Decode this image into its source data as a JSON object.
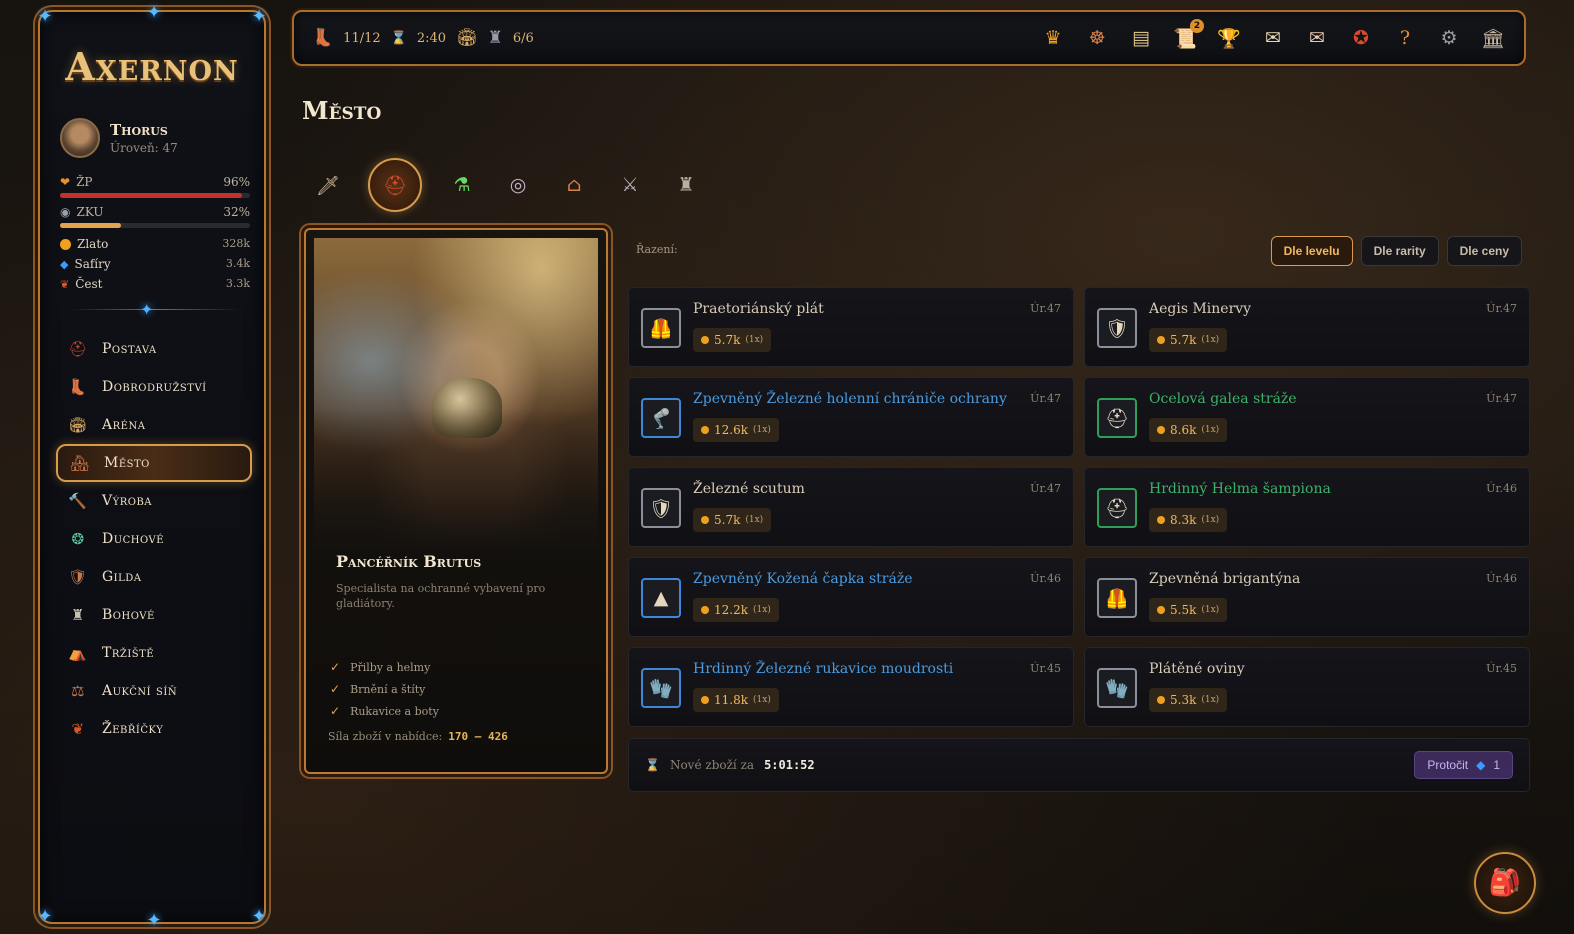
{
  "brand": {
    "logo": "Axernon"
  },
  "player": {
    "name": "Thorus",
    "level_label": "Úroveň: 47"
  },
  "stats": {
    "hp": {
      "label": "ŽP",
      "value": "96%",
      "fraction": 0.96,
      "color": "#c4302a"
    },
    "xp": {
      "label": "ZKU",
      "value": "32%",
      "fraction": 0.32,
      "color": "#e2a450"
    }
  },
  "resources": [
    {
      "label": "Zlato",
      "value": "328k",
      "color": "#f0a020"
    },
    {
      "label": "Safíry",
      "value": "3.4k",
      "color": "#3a9cff"
    },
    {
      "label": "Čest",
      "value": "3.3k",
      "color": "#d8582a"
    }
  ],
  "nav": [
    {
      "label": "Postava",
      "icon": "helmet-icon"
    },
    {
      "label": "Dobrodružství",
      "icon": "boot-icon"
    },
    {
      "label": "Aréna",
      "icon": "colosseum-icon"
    },
    {
      "label": "Město",
      "icon": "town-icon",
      "active": true
    },
    {
      "label": "Výroba",
      "icon": "hammer-icon"
    },
    {
      "label": "Duchové",
      "icon": "spirit-icon"
    },
    {
      "label": "Gilda",
      "icon": "shield-icon"
    },
    {
      "label": "Bohové",
      "icon": "statue-icon"
    },
    {
      "label": "Tržiště",
      "icon": "market-icon"
    },
    {
      "label": "Aukční síň",
      "icon": "auction-icon"
    },
    {
      "label": "Žebříčky",
      "icon": "laurel-icon"
    }
  ],
  "topbar": {
    "expeditions": "11/12",
    "timer": "2:40",
    "dungeon": "6/6",
    "quest_badge": "2"
  },
  "page": {
    "title": "Město"
  },
  "merchant": {
    "name": "Pancéřník Brutus",
    "description": "Specialista na ochranné vybavení pro gladiátory.",
    "specialties": [
      "Přilby a helmy",
      "Brnění a štíty",
      "Rukavice a boty"
    ],
    "power_label": "Síla zboží v nabídce:",
    "power_range": "170 – 426"
  },
  "sort": {
    "label": "Řazení:",
    "options": [
      "Dle levelu",
      "Dle rarity",
      "Dle ceny"
    ],
    "active": "Dle levelu"
  },
  "items": [
    {
      "name": "Praetoriánský plát",
      "level": "Úr.47",
      "price": "5.7k",
      "qty": "(1x)",
      "rarity_color": "#d8ccb6",
      "border": "#8a8f99",
      "icon": "breastplate-icon",
      "glyph": "🦺"
    },
    {
      "name": "Aegis Minervy",
      "level": "Úr.47",
      "price": "5.7k",
      "qty": "(1x)",
      "rarity_color": "#d8ccb6",
      "border": "#8a8f99",
      "icon": "shield-icon",
      "glyph": "🛡"
    },
    {
      "name": "Zpevněný Železné holenní chrániče ochrany",
      "level": "Úr.47",
      "price": "12.6k",
      "qty": "(1x)",
      "rarity_color": "#4a9be0",
      "border": "#3d87d6",
      "icon": "greaves-icon",
      "glyph": "🦿"
    },
    {
      "name": "Ocelová galea stráže",
      "level": "Úr.47",
      "price": "8.6k",
      "qty": "(1x)",
      "rarity_color": "#3cb26a",
      "border": "#2e9e58",
      "icon": "helmet-icon",
      "glyph": "⛑"
    },
    {
      "name": "Železné scutum",
      "level": "Úr.47",
      "price": "5.7k",
      "qty": "(1x)",
      "rarity_color": "#d8ccb6",
      "border": "#8a8f99",
      "icon": "shield-icon",
      "glyph": "🛡"
    },
    {
      "name": "Hrdinný Helma šampiona",
      "level": "Úr.46",
      "price": "8.3k",
      "qty": "(1x)",
      "rarity_color": "#3cb26a",
      "border": "#2e9e58",
      "icon": "helmet-icon",
      "glyph": "⛑"
    },
    {
      "name": "Zpevněný Kožená čapka stráže",
      "level": "Úr.46",
      "price": "12.2k",
      "qty": "(1x)",
      "rarity_color": "#4a9be0",
      "border": "#3d87d6",
      "icon": "cap-icon",
      "glyph": "▲"
    },
    {
      "name": "Zpevněná brigantýna",
      "level": "Úr.46",
      "price": "5.5k",
      "qty": "(1x)",
      "rarity_color": "#d8ccb6",
      "border": "#8a8f99",
      "icon": "brigandine-icon",
      "glyph": "🦺"
    },
    {
      "name": "Hrdinný Železné rukavice moudrosti",
      "level": "Úr.45",
      "price": "11.8k",
      "qty": "(1x)",
      "rarity_color": "#4a9be0",
      "border": "#3d87d6",
      "icon": "gauntlet-icon",
      "glyph": "🧤"
    },
    {
      "name": "Plátěné oviny",
      "level": "Úr.45",
      "price": "5.3k",
      "qty": "(1x)",
      "rarity_color": "#d8ccb6",
      "border": "#8a8f99",
      "icon": "wraps-icon",
      "glyph": "🧤"
    }
  ],
  "restock": {
    "label": "Nové zboží za",
    "timer": "5:01:52",
    "reroll_label": "Protočit",
    "reroll_cost": "1"
  }
}
